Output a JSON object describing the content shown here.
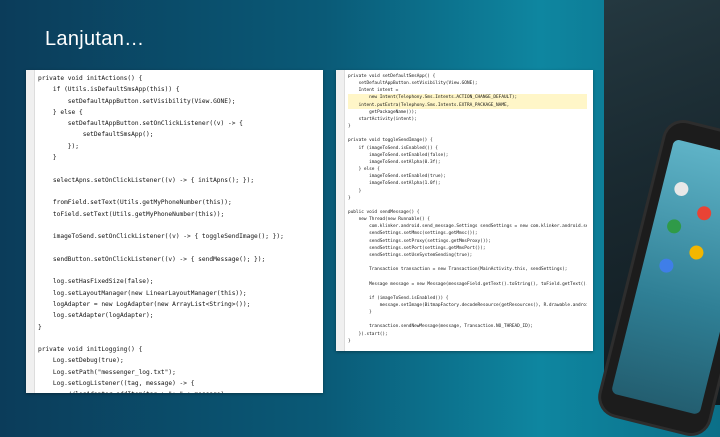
{
  "slide": {
    "title": "Lanjutan…"
  },
  "left_code": [
    {
      "text": "private void initActions() {"
    },
    {
      "text": "    if (Utils.isDefaultSmsApp(this)) {"
    },
    {
      "text": "        setDefaultAppButton.setVisibility(View.GONE);"
    },
    {
      "text": "    } else {"
    },
    {
      "text": "        setDefaultAppButton.setOnClickListener((v) -> {"
    },
    {
      "text": "            setDefaultSmsApp();"
    },
    {
      "text": "        });"
    },
    {
      "text": "    }"
    },
    {
      "text": ""
    },
    {
      "text": "    selectApns.setOnClickListener((v) -> { initApns(); });"
    },
    {
      "text": ""
    },
    {
      "text": "    fromField.setText(Utils.getMyPhoneNumber(this));"
    },
    {
      "text": "    toField.setText(Utils.getMyPhoneNumber(this));"
    },
    {
      "text": ""
    },
    {
      "text": "    imageToSend.setOnClickListener((v) -> { toggleSendImage(); });"
    },
    {
      "text": ""
    },
    {
      "text": "    sendButton.setOnClickListener((v) -> { sendMessage(); });"
    },
    {
      "text": ""
    },
    {
      "text": "    log.setHasFixedSize(false);"
    },
    {
      "text": "    log.setLayoutManager(new LinearLayoutManager(this));"
    },
    {
      "text": "    logAdapter = new LogAdapter(new ArrayList<String>());"
    },
    {
      "text": "    log.setAdapter(logAdapter);"
    },
    {
      "text": "}"
    },
    {
      "text": ""
    },
    {
      "text": "private void initLogging() {"
    },
    {
      "text": "    Log.setDebug(true);"
    },
    {
      "text": "    Log.setPath(\"messenger_log.txt\");"
    },
    {
      "text": "    Log.setLogListener((tag, message) -> {"
    },
    {
      "text": "        //logAdapter.addItem(tag + \": \" + message);"
    },
    {
      "text": "    });"
    },
    {
      "text": "}"
    }
  ],
  "right_code": [
    {
      "text": "private void setDefaultSmsApp() {",
      "hl": false
    },
    {
      "text": "    setDefaultAppButton.setVisibility(View.GONE);",
      "hl": false
    },
    {
      "text": "    Intent intent =",
      "hl": false
    },
    {
      "text": "        new Intent(Telephony.Sms.Intents.ACTION_CHANGE_DEFAULT);",
      "hl": true
    },
    {
      "text": "    intent.putExtra(Telephony.Sms.Intents.EXTRA_PACKAGE_NAME,",
      "hl": true
    },
    {
      "text": "        getPackageName());",
      "hl": false
    },
    {
      "text": "    startActivity(intent);",
      "hl": false
    },
    {
      "text": "}",
      "hl": false
    },
    {
      "text": "",
      "hl": false
    },
    {
      "text": "private void toggleSendImage() {",
      "hl": false
    },
    {
      "text": "    if (imageToSend.isEnabled()) {",
      "hl": false
    },
    {
      "text": "        imageToSend.setEnabled(false);",
      "hl": false
    },
    {
      "text": "        imageToSend.setAlpha(0.3f);",
      "hl": false
    },
    {
      "text": "    } else {",
      "hl": false
    },
    {
      "text": "        imageToSend.setEnabled(true);",
      "hl": false
    },
    {
      "text": "        imageToSend.setAlpha(1.0f);",
      "hl": false
    },
    {
      "text": "    }",
      "hl": false
    },
    {
      "text": "}",
      "hl": false
    },
    {
      "text": "",
      "hl": false
    },
    {
      "text": "public void sendMessage() {",
      "hl": false
    },
    {
      "text": "    new Thread(new Runnable() {",
      "hl": false
    },
    {
      "text": "        com.klinker.android.send_message.Settings sendSettings = new com.klinker.android.send_message.Settings();",
      "hl": false
    },
    {
      "text": "        sendSettings.setMmsc(settings.getMmsc());",
      "hl": false
    },
    {
      "text": "        sendSettings.setProxy(settings.getMmsProxy());",
      "hl": false
    },
    {
      "text": "        sendSettings.setPort(settings.getMmsPort());",
      "hl": false
    },
    {
      "text": "        sendSettings.setUseSystemSending(true);",
      "hl": false
    },
    {
      "text": "",
      "hl": false
    },
    {
      "text": "        Transaction transaction = new Transaction(MainActivity.this, sendSettings);",
      "hl": false
    },
    {
      "text": "",
      "hl": false
    },
    {
      "text": "        Message message = new Message(messageField.getText().toString(), toField.getText().toString());",
      "hl": false
    },
    {
      "text": "",
      "hl": false
    },
    {
      "text": "        if (imageToSend.isEnabled()) {",
      "hl": false
    },
    {
      "text": "            message.setImage(BitmapFactory.decodeResource(getResources(), R.drawable.android));",
      "hl": false
    },
    {
      "text": "        }",
      "hl": false
    },
    {
      "text": "",
      "hl": false
    },
    {
      "text": "        transaction.sendNewMessage(message, Transaction.NO_THREAD_ID);",
      "hl": false
    },
    {
      "text": "    }).start();",
      "hl": false
    },
    {
      "text": "}",
      "hl": false
    }
  ]
}
